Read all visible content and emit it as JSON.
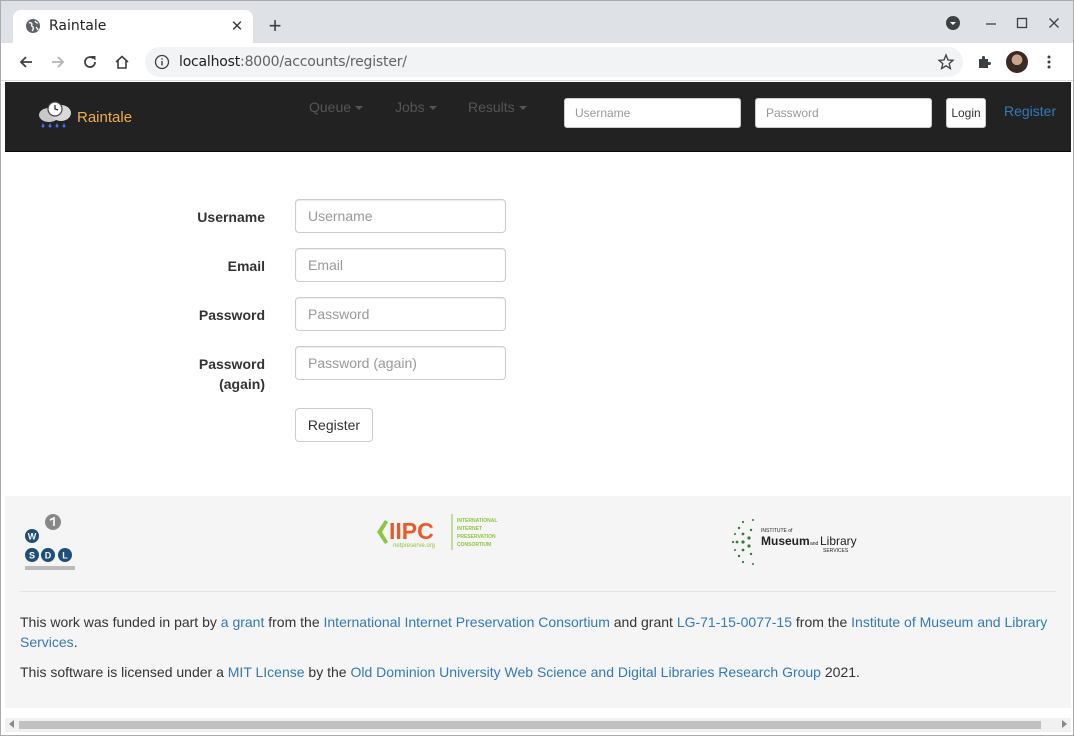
{
  "browser": {
    "tab_title": "Raintale",
    "url_host": "localhost",
    "url_rest": ":8000/accounts/register/"
  },
  "navbar": {
    "brand": "Raintale",
    "menus": [
      "Queue",
      "Jobs",
      "Results"
    ],
    "username_placeholder": "Username",
    "password_placeholder": "Password",
    "login_label": "Login",
    "register_label": "Register"
  },
  "form": {
    "username_label": "Username",
    "username_placeholder": "Username",
    "email_label": "Email",
    "email_placeholder": "Email",
    "password_label": "Password",
    "password_placeholder": "Password",
    "password2_label_1": "Password",
    "password2_label_2": "(again)",
    "password2_placeholder": "Password (again)",
    "submit_label": "Register"
  },
  "footer": {
    "logos": {
      "wsdl_letters": [
        "W",
        "S",
        "D",
        "L"
      ],
      "iipc_name": "IIPC",
      "iipc_url": "netpreserve.org",
      "iipc_lines": [
        "INTERNATIONAL",
        "INTERNET",
        "PRESERVATION",
        "CONSORTIUM"
      ],
      "imls_small": "INSTITUTE of",
      "imls_main": "Museum",
      "imls_and": "and",
      "imls_main2": "Library",
      "imls_sub": "SERVICES"
    },
    "funding": {
      "t1": "This work was funded in part by ",
      "l1": "a grant",
      "t2": " from the ",
      "l2": "International Internet Preservation Consortium",
      "t3": " and grant ",
      "l3": "LG-71-15-0077-15",
      "t4": " from the ",
      "l4": "Institute of Museum and Library Services",
      "t5": "."
    },
    "license": {
      "t1": "This software is licensed under a ",
      "l1": "MIT LIcense",
      "t2": " by the ",
      "l2": "Old Dominion University Web Science and Digital Libraries Research Group",
      "t3": " 2021."
    }
  },
  "colors": {
    "navbar_bg": "#222222",
    "brand": "#f0ad4e",
    "link": "#337ab7"
  }
}
